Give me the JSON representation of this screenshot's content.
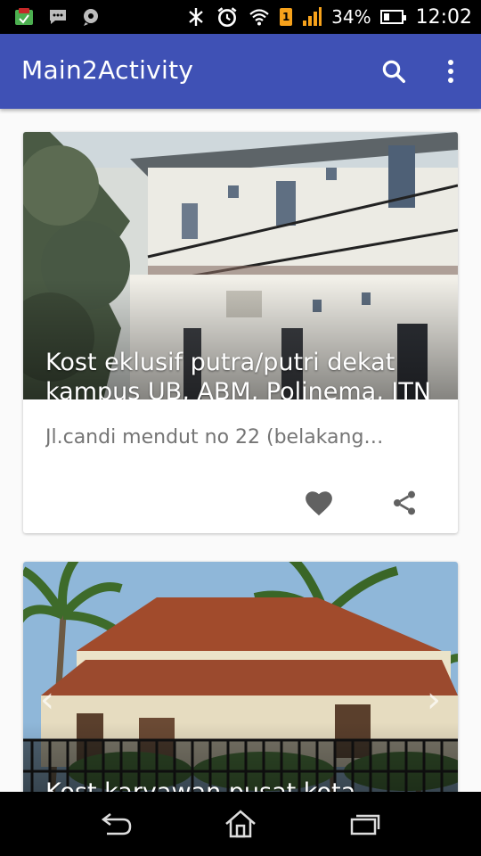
{
  "status_bar": {
    "battery_percent": "34%",
    "sim_badge": "1",
    "time": "12:02",
    "notification_icons": [
      "app-notification-icon",
      "chat-notification-icon",
      "location-chat-icon"
    ],
    "system_icons": [
      "bluetooth-icon",
      "alarm-icon",
      "wifi-icon",
      "sim-icon",
      "signal-icon",
      "battery-icon"
    ]
  },
  "app_bar": {
    "title": "Main2Activity",
    "color": "#3f51b5",
    "actions": [
      "search-icon",
      "overflow-menu-icon"
    ]
  },
  "cards": [
    {
      "title": "Kost eklusif putra/putri dekat kampus UB, ABM, Polinema, ITN",
      "subtitle": "Jl.candi mendut no 22 (belakang…",
      "actions": [
        "favorite-icon",
        "share-icon"
      ]
    },
    {
      "title": "Kost karyawan pusat kota malang",
      "carousel_arrows": [
        "chevron-left-icon",
        "chevron-right-icon"
      ]
    }
  ],
  "nav_bar": {
    "buttons": [
      "back-icon",
      "home-icon",
      "recents-icon"
    ]
  }
}
